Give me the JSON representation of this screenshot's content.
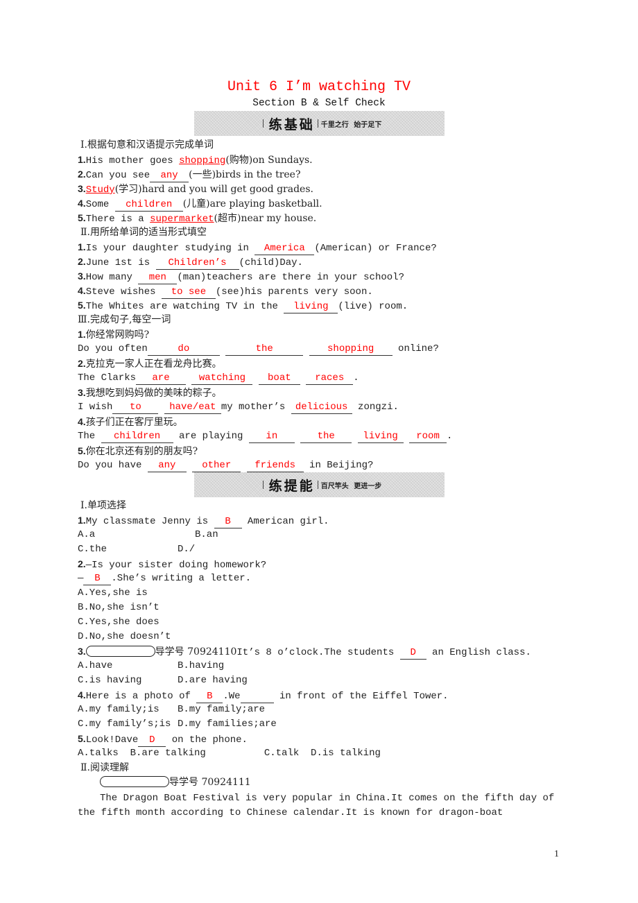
{
  "header": {
    "title": "Unit 6 I’m watching TV",
    "subtitle": "Section B & Self Check"
  },
  "banners": [
    {
      "main": "练基础",
      "motto": "千里之行 始于足下"
    },
    {
      "main": "练提能",
      "motto": "百尺竿头 更进一步"
    }
  ],
  "part1": {
    "section1": {
      "heading": "Ⅰ.根据句意和汉语提示完成单词",
      "items": [
        {
          "n": "1.",
          "pre": "His mother goes ",
          "ans": "shopping",
          "post": "(购物)on Sundays."
        },
        {
          "n": "2.",
          "pre": "Can you see",
          "ans": "any",
          "post": "(一些)birds in the tree?"
        },
        {
          "n": "3.",
          "pre": "",
          "ans": "Study",
          "post": "(学习)hard and you will get good grades."
        },
        {
          "n": "4.",
          "pre": "Some ",
          "ans": "children",
          "post": "(儿童)are playing basketball."
        },
        {
          "n": "5.",
          "pre": "There is a ",
          "ans": "supermarket",
          "post": "(超市)near my house."
        }
      ]
    },
    "section2": {
      "heading": "Ⅱ.用所给单词的适当形式填空",
      "items": [
        {
          "n": "1.",
          "pre": "Is your daughter studying in ",
          "ans": "America",
          "post": "(American) or France?"
        },
        {
          "n": "2.",
          "pre": "June 1st is ",
          "ans": "Children’s",
          "post": "(child)Day."
        },
        {
          "n": "3.",
          "pre": "How many ",
          "ans": "men",
          "post": "(man)teachers are there in your school?"
        },
        {
          "n": "4.",
          "pre": "Steve wishes ",
          "ans": "to see",
          "post": "(see)his parents very soon."
        },
        {
          "n": "5.",
          "pre": "The Whites are watching TV in the ",
          "ans": "living",
          "post": "(live) room."
        }
      ]
    },
    "section3": {
      "heading": "Ⅲ.完成句子,每空一词",
      "items": [
        {
          "n": "1.",
          "cn": "你经常网购吗?",
          "en_pre": "Do you often",
          "answers": [
            "do",
            "the",
            "shopping"
          ],
          "en_post": " online?"
        },
        {
          "n": "2.",
          "cn": "克拉克一家人正在看龙舟比赛。",
          "en_pre": "The Clarks",
          "answers": [
            "are",
            "watching",
            "boat",
            "races"
          ],
          "en_post": "."
        },
        {
          "n": "3.",
          "cn": "我想吃到妈妈做的美味的粽子。",
          "en_pre": "I wish",
          "answers": [
            "to",
            "have/eat",
            "delicious"
          ],
          "mid": "my mother’s ",
          "en_post": " zongzi."
        },
        {
          "n": "4.",
          "cn": "孩子们正在客厅里玩。",
          "en_pre": "The ",
          "answers": [
            "children",
            "in",
            "the",
            "living",
            "room"
          ],
          "mid": " are playing ",
          "en_post": "."
        },
        {
          "n": "5.",
          "cn": "你在北京还有别的朋友吗?",
          "en_pre": "Do you have ",
          "answers": [
            "any",
            "other",
            "friends"
          ],
          "en_post": " in Beijing?"
        }
      ]
    }
  },
  "part2": {
    "section1": {
      "heading": "Ⅰ.单项选择",
      "q1": {
        "n": "1.",
        "pre": "My classmate Jenny is ",
        "ans": "B",
        "post": " American girl.",
        "A": "A.a",
        "B": "B.an",
        "C": "C.the",
        "D": "D./"
      },
      "q2": {
        "n": "2.",
        "stem": "—Is your sister doing homework?",
        "pre": "—",
        "ans": "B",
        "post": ".She’s writing a letter.",
        "A": "A.Yes,she is",
        "B": "B.No,she isn’t",
        "C": "C.Yes,she does",
        "D": "D.No,she doesn’t"
      },
      "q3": {
        "n": "3.",
        "guide": "导学号 70924110",
        "pre": "It’s 8 o’clock.The students ",
        "ans": "D",
        "post": " an English class.",
        "A": "A.have",
        "B": "B.having",
        "C": "C.is having",
        "D": "D.are having"
      },
      "q4": {
        "n": "4.",
        "pre": "Here is a photo of ",
        "ans": "B",
        "post1": ".We",
        "post2": " in front of the Eiffel Tower.",
        "A": "A.my family;is",
        "B": "B.my family;are",
        "C": "C.my family’s;is",
        "D": "D.my families;are"
      },
      "q5": {
        "n": "5.",
        "pre": "Look!Dave",
        "ans": "D",
        "post": " on the phone.",
        "options": "A.talks  B.are talking          C.talk  D.is talking"
      }
    },
    "section2": {
      "heading": "Ⅱ.阅读理解",
      "guide": "导学号 70924111",
      "para_line1": "The Dragon Boat Festival is very popular in China.It comes on the fifth day of",
      "para_line2": "the fifth month according to Chinese calendar.It is known for dragon-boat"
    }
  },
  "footer": {
    "page_number": "1"
  }
}
